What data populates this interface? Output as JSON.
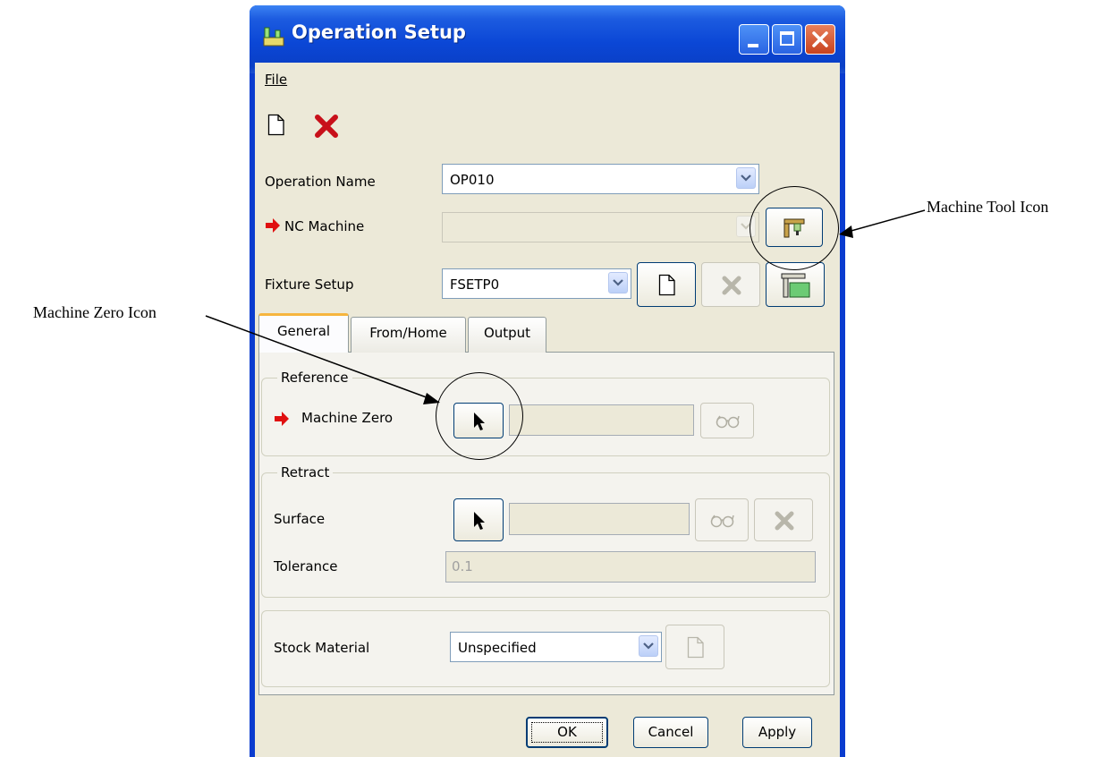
{
  "window": {
    "title": "Operation Setup"
  },
  "menu": {
    "file": "File"
  },
  "toolbar": {
    "new_icon": "new-document-icon",
    "delete_icon": "red-x-icon"
  },
  "form": {
    "operation_name": {
      "label": "Operation Name",
      "value": "OP010"
    },
    "nc_machine": {
      "label": "NC Machine",
      "value": ""
    },
    "fixture_setup": {
      "label": "Fixture Setup",
      "value": "FSETP0"
    }
  },
  "tabs": [
    {
      "label": "General",
      "active": true
    },
    {
      "label": "From/Home",
      "active": false
    },
    {
      "label": "Output",
      "active": false
    }
  ],
  "reference": {
    "group_label": "Reference",
    "machine_zero_label": "Machine Zero",
    "machine_zero_value": ""
  },
  "retract": {
    "group_label": "Retract",
    "surface_label": "Surface",
    "surface_value": "",
    "tolerance_label": "Tolerance",
    "tolerance_value": "0.1"
  },
  "stock": {
    "label": "Stock Material",
    "value": "Unspecified"
  },
  "buttons": {
    "ok": "OK",
    "cancel": "Cancel",
    "apply": "Apply"
  },
  "annotations": {
    "machine_tool": "Machine Tool Icon",
    "machine_zero": "Machine Zero Icon"
  },
  "colors": {
    "title_bar": "#0b47d6",
    "dialog_bg": "#ece9d8",
    "accent_red": "#e01010"
  }
}
